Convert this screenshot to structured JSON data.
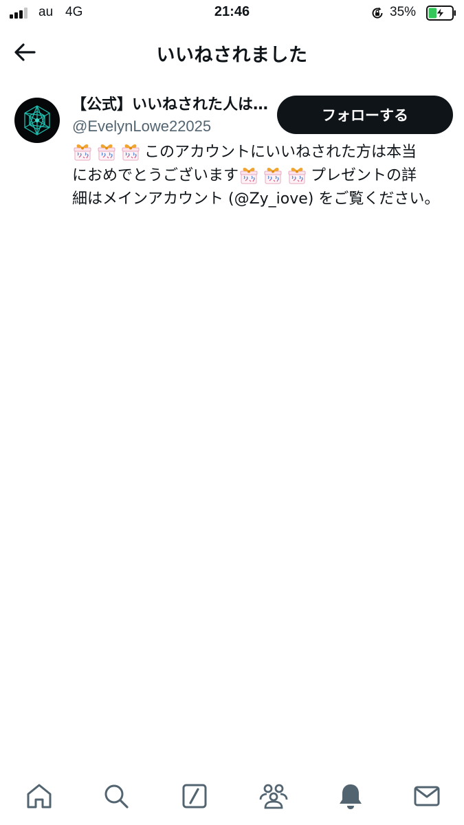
{
  "status_bar": {
    "carrier": "au",
    "network": "4G",
    "time": "21:46",
    "battery_percent": "35%",
    "battery_level": 0.35,
    "charging": true,
    "icons": [
      "signal-icon",
      "rotation-lock-icon",
      "battery-icon"
    ]
  },
  "header": {
    "title": "いいねされました",
    "back_icon": "arrow-left-icon"
  },
  "user": {
    "display_name": "【公式】いいねされた人は…",
    "handle": "@EvelynLowe22025",
    "follow_label": "フォローする",
    "bio_lines": [
      {
        "emoji_count": 3,
        "text": "このアカウントにいいねされた方は本当"
      },
      {
        "emoji_count": 0,
        "text": "におめでとうございます"
      },
      {
        "emoji_count": 3,
        "text": "プレゼントの詳"
      },
      {
        "emoji_count": 0,
        "text": "細はメインアカウント (@Zy_iove) をご覧ください。"
      }
    ],
    "bio_emoji": "gift-icon"
  },
  "tabs": [
    {
      "icon": "home-icon"
    },
    {
      "icon": "search-icon"
    },
    {
      "icon": "compose-icon"
    },
    {
      "icon": "communities-icon"
    },
    {
      "icon": "notifications-icon",
      "active": true
    },
    {
      "icon": "messages-icon"
    }
  ],
  "colors": {
    "text": "#0f1419",
    "secondary_text": "#536471",
    "button_bg": "#0f1419",
    "battery_green": "#34c759",
    "avatar_accent": "#1fbfb0"
  }
}
